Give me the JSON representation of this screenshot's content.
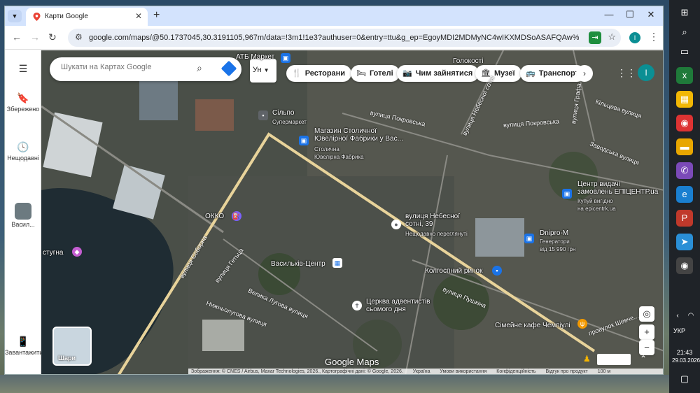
{
  "browser": {
    "tab_title": "Карти Google",
    "tab_close": "✕",
    "new_tab": "+",
    "url": "google.com/maps/@50.1737045,30.3191105,967m/data=!3m1!1e3?authuser=0&entry=ttu&g_ep=EgoyMDI2MDMyNC4wIKXMDSoASAFQAw%3D%3D",
    "profile_initial": "I"
  },
  "rail": {
    "menu_icon": "☰",
    "saved_label": "Збережено",
    "recent_label": "Нещодавні",
    "recent_place_label": "Васил...",
    "install_label": "Завантажити..."
  },
  "search": {
    "placeholder": "Шукати на Картах Google",
    "lang_label": "Ун"
  },
  "chips": [
    {
      "icon": "🍴",
      "label": "Ресторани"
    },
    {
      "icon": "🛏",
      "label": "Готелі"
    },
    {
      "icon": "📷",
      "label": "Чим зайнятися"
    },
    {
      "icon": "🏛",
      "label": "Музеї"
    },
    {
      "icon": "🚌",
      "label": "Транспорт"
    }
  ],
  "map_avatar": "I",
  "pois": {
    "atb": "АТБ Маркет",
    "holokosty": "Голокості",
    "silpo": "Сільпо",
    "silpo_sub": "Супермаркет",
    "jewel": "Магазин Столичної\nЮвелірної Фабрики у Вас...",
    "jewel_sub": "Столична\nЮвелірна Фабрика",
    "epicentr": "Центр видачі\nзамовлень ЕПІЦЕНТР.ua",
    "epicentr_sub": "Купуй вигідно\nна epicentrk.ua",
    "nebesnoi": "вулиця Небесної\nсотні, 39",
    "nebesnoi_sub": "Нещодавно переглянуті",
    "dnipro": "Dnipro-M",
    "dnipro_sub": "Генератори\nвід 15 990 грн",
    "okko": "ОККО",
    "stuhna": "стугна",
    "vasylkiv_center": "Васильків-Центр",
    "kolhosp": "Колгоспний ринок",
    "church": "Церква адвентистів\nсьомого дня",
    "cafe": "Сімейне кафе Чемпіулі"
  },
  "streets": {
    "pokrovska1": "вулиця Покровська",
    "pokrovska2": "вулиця Покровська",
    "nebesnoi_st": "вулиця Небесної сотні",
    "hrafa": "вулиця Графа",
    "kiltseva": "Кільцева вулиця",
    "zavodska": "Заводська вулиця",
    "soborna": "вулиця Соборна",
    "hetsa": "вулиця Гетьца",
    "velyka": "Велика Луговa вулиця",
    "nyzhnia": "Нижньолугова вулиця",
    "pushkina": "вулиця Пушкіна",
    "shevchenka": "провулок Шевче..."
  },
  "layers_label": "Шари",
  "brand": "Google Maps",
  "attribution": [
    "Зображення: © CNES / Airbus, Maxar Technologies, 2026., Картографічні дані: © Google, 2026.",
    "Україна",
    "Умови використання",
    "Конфіденційність",
    "Відгук про продукт",
    "100 м"
  ],
  "taskbar": {
    "lang": "УКР",
    "time": "21:43",
    "date": "29.03.2026"
  }
}
